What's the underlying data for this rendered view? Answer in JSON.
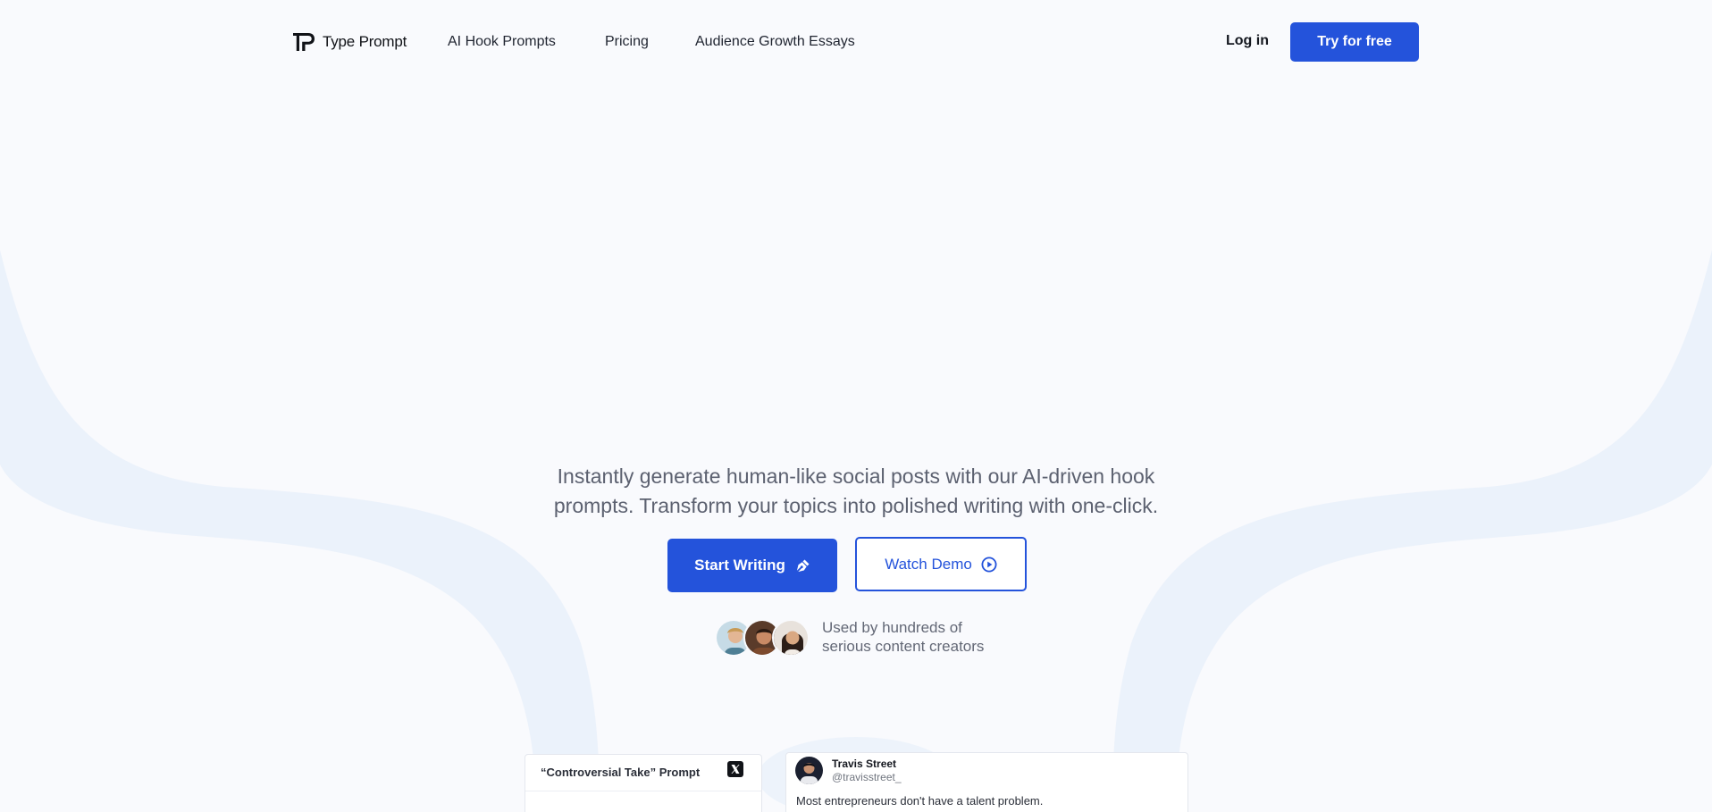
{
  "colors": {
    "accent": "#2453db",
    "background": "#f9fafd",
    "swoosh": "#e9f0fa"
  },
  "nav": {
    "logo_text": "Type Prompt",
    "links": [
      "AI Hook Prompts",
      "Pricing",
      "Audience Growth Essays"
    ],
    "login_label": "Log in",
    "try_label": "Try for free"
  },
  "hero": {
    "subtitle_line1": "Instantly generate human-like social posts with our AI-driven hook",
    "subtitle_line2": "prompts. Transform your topics into polished writing with one-click.",
    "start_label": "Start Writing",
    "start_icon": "pen-nib-icon",
    "demo_label": "Watch Demo",
    "demo_icon": "play-circle-icon",
    "proof_line1": "Used by hundreds of",
    "proof_line2": "serious content creators"
  },
  "cards": {
    "prompt_title": "“Controversial Take” Prompt",
    "prompt_icon": "x-logo-icon",
    "tweet_name": "Travis Street",
    "tweet_handle": "@travisstreet_",
    "tweet_text": "Most entrepreneurs don't have a talent problem."
  }
}
